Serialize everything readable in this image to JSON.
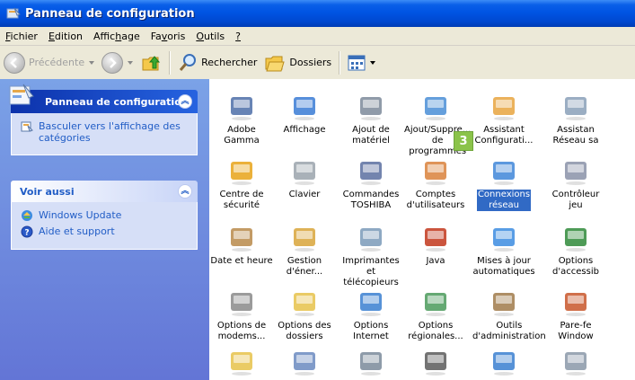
{
  "window": {
    "title": "Panneau de configuration"
  },
  "menu": [
    {
      "pre": "",
      "u": "F",
      "post": "ichier"
    },
    {
      "pre": "",
      "u": "E",
      "post": "dition"
    },
    {
      "pre": "Affic",
      "u": "h",
      "post": "age"
    },
    {
      "pre": "Fa",
      "u": "v",
      "post": "oris"
    },
    {
      "pre": "",
      "u": "O",
      "post": "utils"
    },
    {
      "pre": "",
      "u": "?",
      "post": ""
    }
  ],
  "toolbar": {
    "back_label": "Précédente",
    "search_label": "Rechercher",
    "folders_label": "Dossiers"
  },
  "taskpane": {
    "main_title": "Panneau de configuration",
    "switch_view": "Basculer vers l'affichage des catégories",
    "see_also_title": "Voir aussi",
    "links": [
      "Windows Update",
      "Aide et support"
    ]
  },
  "items": [
    {
      "label": "Adobe Gamma",
      "icon": "monitor-icon",
      "color": "#4d6fa8"
    },
    {
      "label": "Affichage",
      "icon": "display-icon",
      "color": "#3a7bd5"
    },
    {
      "label": "Ajout de\nmatériel",
      "icon": "hardware-icon",
      "color": "#7c8a9a"
    },
    {
      "label": "Ajout/Suppre...\nde programmes",
      "icon": "add-remove-icon",
      "color": "#4a8ed6"
    },
    {
      "label": "Assistant\nConfigurati...",
      "icon": "network-setup-icon",
      "color": "#e7a540"
    },
    {
      "label": "Assistan\nRéseau sa",
      "icon": "wireless-icon",
      "color": "#8aa0b8"
    },
    {
      "label": "Centre de\nsécurité",
      "icon": "shield-icon",
      "color": "#e8a319"
    },
    {
      "label": "Clavier",
      "icon": "keyboard-icon",
      "color": "#9aa3ab"
    },
    {
      "label": "Commandes\nTOSHIBA",
      "icon": "toshiba-icon",
      "color": "#5a6fa0"
    },
    {
      "label": "Comptes\nd'utilisateurs",
      "icon": "users-icon",
      "color": "#d9813b"
    },
    {
      "label": "Connexions\nréseau",
      "icon": "globe-icon",
      "color": "#3f86d8"
    },
    {
      "label": "Contrôleur\njeu",
      "icon": "gamepad-icon",
      "color": "#8a92a8"
    },
    {
      "label": "Date et heure",
      "icon": "clock-icon",
      "color": "#b88a4a"
    },
    {
      "label": "Gestion\nd'éner...",
      "icon": "power-icon",
      "color": "#d8a43a"
    },
    {
      "label": "Imprimantes et\ntélécopieurs",
      "icon": "printer-icon",
      "color": "#7a9ab8"
    },
    {
      "label": "Java",
      "icon": "java-icon",
      "color": "#c2371c"
    },
    {
      "label": "Mises à jour\nautomatiques",
      "icon": "update-icon",
      "color": "#3c8ce0"
    },
    {
      "label": "Options\nd'accessib",
      "icon": "accessibility-icon",
      "color": "#2f8a3a"
    },
    {
      "label": "Options de\nmodems...",
      "icon": "modem-icon",
      "color": "#8a8a8a"
    },
    {
      "label": "Options des\ndossiers",
      "icon": "folder-icon",
      "color": "#e6c24a"
    },
    {
      "label": "Options Internet",
      "icon": "internet-icon",
      "color": "#3a7fd0"
    },
    {
      "label": "Options\nrégionales...",
      "icon": "regional-icon",
      "color": "#4a9a5a"
    },
    {
      "label": "Outils\nd'administration",
      "icon": "admin-tools-icon",
      "color": "#a07a4a"
    },
    {
      "label": "Pare-fe\nWindow",
      "icon": "firewall-icon",
      "color": "#c8562a"
    },
    {
      "label": "",
      "icon": "folder-icon",
      "color": "#e6c24a"
    },
    {
      "label": "",
      "icon": "fonts-icon",
      "color": "#6a8ac0"
    },
    {
      "label": "",
      "icon": "scheduled-tasks-icon",
      "color": "#7a8a9a"
    },
    {
      "label": "",
      "icon": "sounds-icon",
      "color": "#5a5a5a"
    },
    {
      "label": "",
      "icon": "cd-icon",
      "color": "#3a7fd0"
    },
    {
      "label": "",
      "icon": "scanner-icon",
      "color": "#8a98a8"
    }
  ],
  "selected_index": 10,
  "badge": "3"
}
